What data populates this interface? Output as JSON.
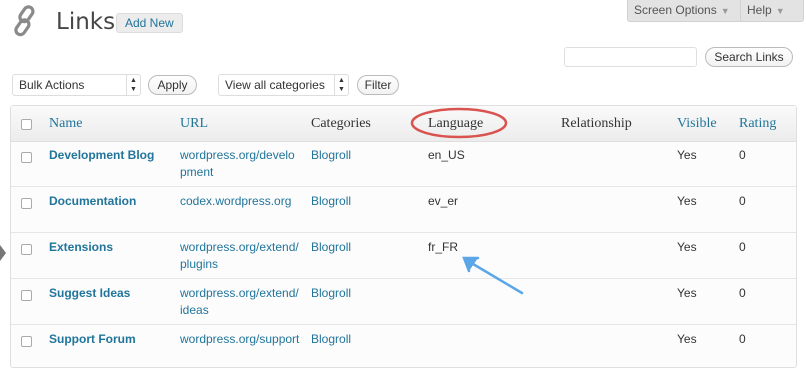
{
  "header": {
    "title": "Links",
    "add_new": "Add New",
    "icon": "links-icon"
  },
  "screen_options": {
    "screen_options_label": "Screen Options",
    "help_label": "Help"
  },
  "search": {
    "placeholder": "",
    "value": "",
    "button_label": "Search Links"
  },
  "toolbar": {
    "bulk_actions_selected": "Bulk Actions",
    "apply_label": "Apply",
    "category_selected": "View all categories",
    "filter_label": "Filter"
  },
  "table": {
    "columns": {
      "name": "Name",
      "url": "URL",
      "categories": "Categories",
      "language": "Language",
      "relationship": "Relationship",
      "visible": "Visible",
      "rating": "Rating"
    },
    "rows": [
      {
        "name": "Development Blog",
        "url": "wordpress.org/development",
        "category": "Blogroll",
        "language": "en_US",
        "relationship": "",
        "visible": "Yes",
        "rating": "0"
      },
      {
        "name": "Documentation",
        "url": "codex.wordpress.org",
        "category": "Blogroll",
        "language": "ev_er",
        "relationship": "",
        "visible": "Yes",
        "rating": "0"
      },
      {
        "name": "Extensions",
        "url": "wordpress.org/extend/plugins",
        "category": "Blogroll",
        "language": "fr_FR",
        "relationship": "",
        "visible": "Yes",
        "rating": "0"
      },
      {
        "name": "Suggest Ideas",
        "url": "wordpress.org/extend/ideas",
        "category": "Blogroll",
        "language": "",
        "relationship": "",
        "visible": "Yes",
        "rating": "0"
      },
      {
        "name": "Support Forum",
        "url": "wordpress.org/support",
        "category": "Blogroll",
        "language": "",
        "relationship": "",
        "visible": "Yes",
        "rating": "0"
      }
    ]
  },
  "annotations": {
    "highlight_color": "#d9534f",
    "arrow_color": "#5aa6e6"
  },
  "colors": {
    "link": "#21759b",
    "text": "#333333"
  }
}
